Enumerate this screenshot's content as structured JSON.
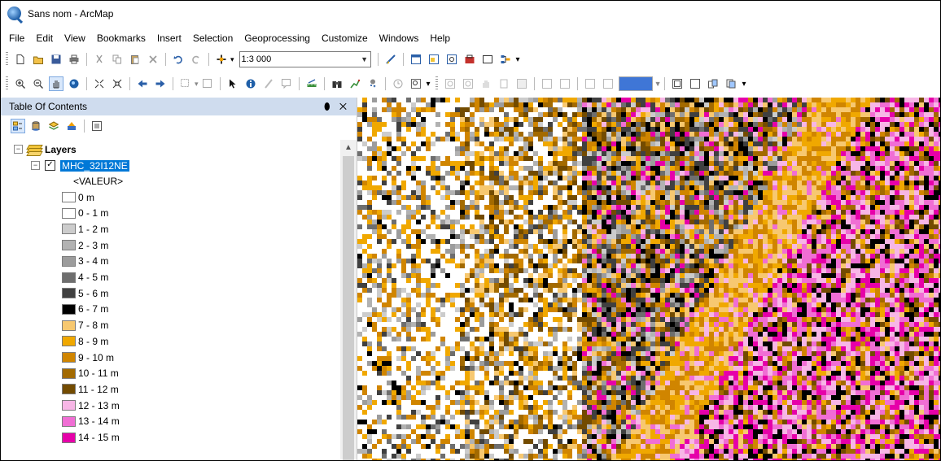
{
  "window": {
    "title": "Sans nom - ArcMap"
  },
  "menu": [
    "File",
    "Edit",
    "View",
    "Bookmarks",
    "Insert",
    "Selection",
    "Geoprocessing",
    "Customize",
    "Windows",
    "Help"
  ],
  "standard_toolbar": {
    "scale_value": "1:3 000"
  },
  "toc": {
    "title": "Table Of Contents",
    "pin": "⬮",
    "close": "✕",
    "root_label": "Layers",
    "layer_label": "MHC_32I12NE",
    "field_label": "<VALEUR>",
    "legend": [
      {
        "label": "0 m",
        "color": "#ffffff"
      },
      {
        "label": "0 - 1 m",
        "color": "#ffffff"
      },
      {
        "label": "1 - 2 m",
        "color": "#cccccc"
      },
      {
        "label": "2 - 3 m",
        "color": "#b2b2b2"
      },
      {
        "label": "3 - 4 m",
        "color": "#9c9c9c"
      },
      {
        "label": "4 - 5 m",
        "color": "#6e6e6e"
      },
      {
        "label": "5 - 6 m",
        "color": "#404040"
      },
      {
        "label": "6 - 7 m",
        "color": "#000000"
      },
      {
        "label": "7 - 8 m",
        "color": "#f7c870"
      },
      {
        "label": "8 - 9 m",
        "color": "#f0a800"
      },
      {
        "label": "9 - 10 m",
        "color": "#d08500"
      },
      {
        "label": "10 - 11 m",
        "color": "#a36a00"
      },
      {
        "label": "11 - 12 m",
        "color": "#734b00"
      },
      {
        "label": "12 - 13 m",
        "color": "#f7b6e6"
      },
      {
        "label": "13 - 14 m",
        "color": "#f06ed4"
      },
      {
        "label": "14 - 15 m",
        "color": "#e600a9"
      }
    ]
  },
  "colors": {
    "toc_header": "#cfdcee",
    "selection": "#0078d7"
  }
}
